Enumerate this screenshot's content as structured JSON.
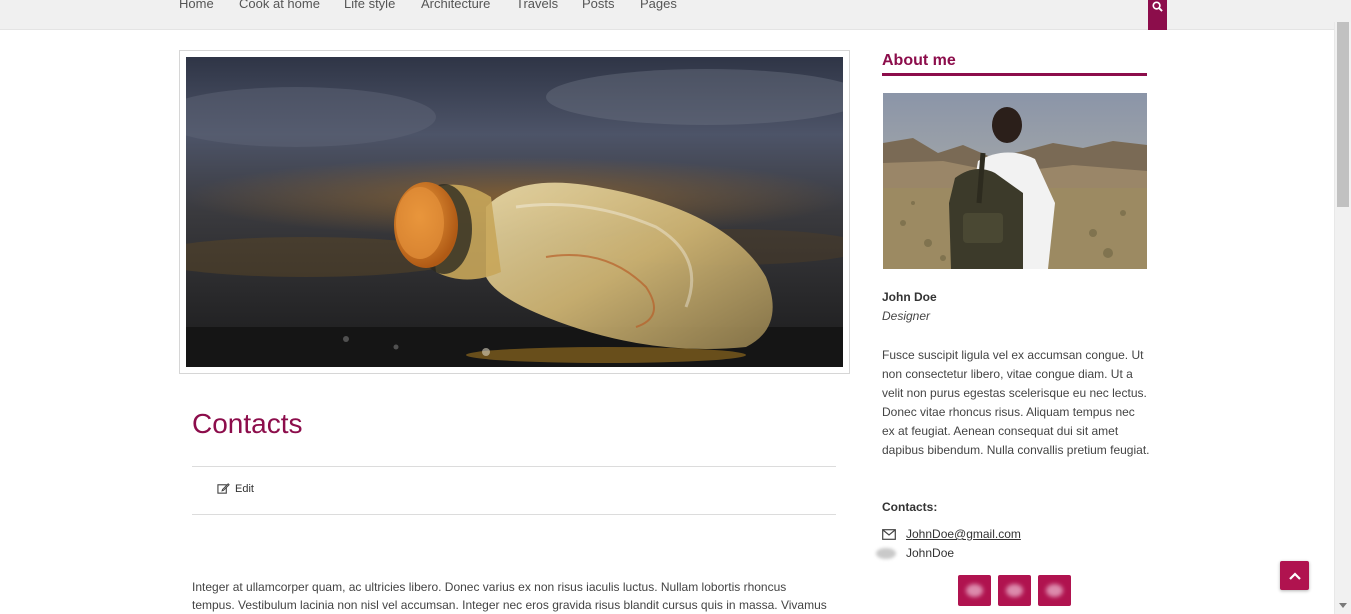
{
  "nav": {
    "items": [
      "Home",
      "Cook at home",
      "Life style",
      "Architecture",
      "Travels",
      "Posts",
      "Pages"
    ]
  },
  "colors": {
    "accent": "#8c0d4b",
    "button": "#b0134f"
  },
  "icons": {
    "search": "search-icon",
    "edit": "edit-icon",
    "email": "envelope-icon",
    "skype": "skype-icon",
    "back_to_top": "chevron-up-icon"
  },
  "main": {
    "title": "Contacts",
    "edit_label": "Edit",
    "body": "Integer at ullamcorper quam, ac ultricies libero. Donec varius ex non risus iaculis luctus. Nullam lobortis rhoncus tempus. Vestibulum lacinia non nisl vel accumsan. Integer nec eros gravida risus blandit cursus quis in massa. Vivamus feugiat"
  },
  "sidebar": {
    "about_title": "About me",
    "name": "John Doe",
    "role": "Designer",
    "bio": "Fusce suscipit ligula vel ex accumsan congue. Ut non consectetur libero, vitae congue diam. Ut a velit non purus egestas scelerisque eu nec lectus. Donec vitae rhoncus risus. Aliquam tempus nec ex at feugiat. Aenean consequat dui sit amet dapibus bibendum. Nulla convallis pretium feugiat.",
    "contacts_label": "Contacts:",
    "email": "JohnDoe@gmail.com",
    "skype": "JohnDoe"
  }
}
